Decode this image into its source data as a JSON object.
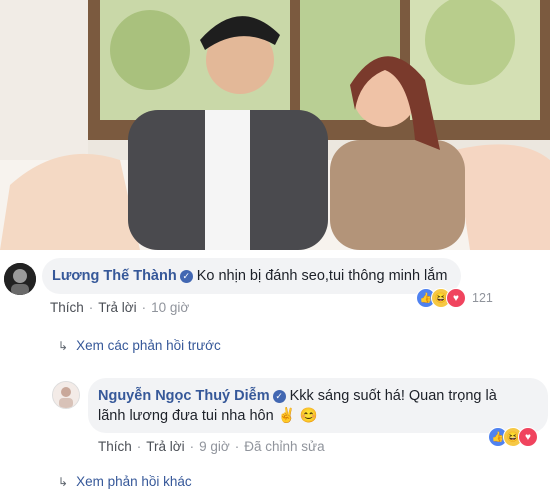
{
  "comments": [
    {
      "author": "Lương Thế Thành",
      "text": "Ko nhịn bị đánh seo,tui thông minh lắm",
      "actions": {
        "like": "Thích",
        "reply": "Trả lời",
        "time": "10 giờ"
      },
      "reaction_count": "121",
      "reactions": [
        "like-icon",
        "haha-icon",
        "love-icon"
      ]
    },
    {
      "author": "Nguyễn Ngọc Thuý Diễm",
      "text_line1": "Kkk sáng suốt há! Quan trọng là",
      "text_line2": "lãnh lương đưa tui nha hôn ✌️ 😊",
      "actions": {
        "like": "Thích",
        "reply": "Trả lời",
        "time": "9 giờ",
        "edited": "Đã chỉnh sửa"
      },
      "reactions": [
        "like-icon",
        "haha-icon",
        "love-icon"
      ]
    }
  ],
  "view_previous": "Xem các phản hồi trước",
  "view_more": "Xem phản hồi khác",
  "colors": {
    "name_blue": "#365899",
    "bubble_bg": "#f2f3f5",
    "like": "#4f82f0",
    "love": "#f0445e",
    "haha": "#f6c844"
  }
}
